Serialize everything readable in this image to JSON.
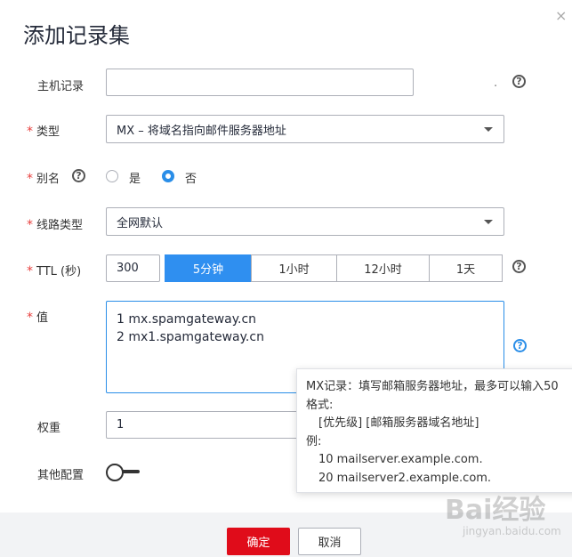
{
  "dialog": {
    "title": "添加记录集",
    "close_glyph": "×"
  },
  "fields": {
    "host": {
      "label": "主机记录",
      "value": "",
      "suffix": "."
    },
    "type": {
      "label": "类型",
      "value": "MX – 将域名指向邮件服务器地址"
    },
    "alias": {
      "label": "别名",
      "options": [
        "是",
        "否"
      ],
      "selected": "否"
    },
    "line": {
      "label": "线路类型",
      "value": "全网默认"
    },
    "ttl": {
      "label": "TTL (秒)",
      "value": "300",
      "presets": [
        "5分钟",
        "1小时",
        "12小时",
        "1天"
      ],
      "selected": "5分钟"
    },
    "value": {
      "label": "值",
      "lines": [
        "1 mx.spamgateway.cn",
        "2 mx1.spamgateway.cn"
      ]
    },
    "weight": {
      "label": "权重",
      "value": "1"
    },
    "other": {
      "label": "其他配置",
      "enabled": false
    }
  },
  "required_mark": "*",
  "help_glyph": "?",
  "tooltip": {
    "line1": "MX记录：填写邮箱服务器地址，最多可以输入50",
    "line2": "格式:",
    "line3": "[优先级] [邮箱服务器域名地址]",
    "line4": "例:",
    "line5": "10 mailserver.example.com.",
    "line6": "20 mailserver2.example.com."
  },
  "buttons": {
    "confirm": "确定",
    "cancel": "取消"
  },
  "watermark": {
    "main": "Bai经验",
    "sub": "jingyan.baidu.com"
  },
  "colors": {
    "accent": "#2a8ee8",
    "primary_button": "#e00c1a",
    "required": "#e8403e"
  }
}
